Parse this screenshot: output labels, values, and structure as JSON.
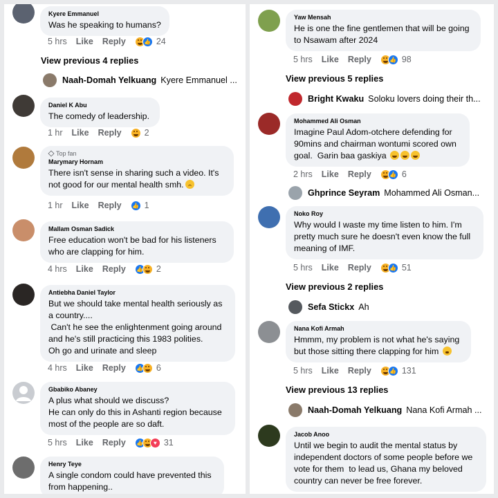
{
  "left": {
    "top_comment": {
      "author": "Kyere Emmanuel",
      "text": "Was he speaking to humans?",
      "time": "5 hrs",
      "like": "Like",
      "reply": "Reply",
      "count": "24"
    },
    "view_previous": "View previous 4 replies",
    "reply_preview": {
      "author": "Naah-Domah Yelkuang",
      "snippet": "Kyere Emmanuel ..."
    },
    "comments": [
      {
        "author": "Daniel K Abu",
        "text": "The comedy of leadership.",
        "time": "1 hr",
        "like": "Like",
        "reply": "Reply",
        "count": "2"
      },
      {
        "badge": "Top fan",
        "author": "Marymary Hornam",
        "text": "There isn't sense in sharing such a video. It's not good for our mental health smh.",
        "time": "1 hr",
        "like": "Like",
        "reply": "Reply",
        "count": "1"
      },
      {
        "author": "Mallam Osman Sadick",
        "text": "Free education won't be bad for his listeners who are clapping for him.",
        "time": "4 hrs",
        "like": "Like",
        "reply": "Reply",
        "count": "2"
      },
      {
        "author": "Antiebha Daniel Taylor",
        "text": "But we should take mental health seriously as a country....\n Can't he see the enlightenment going around and he's still practicing this 1983 polities.\nOh go and urinate and sleep",
        "time": "4 hrs",
        "like": "Like",
        "reply": "Reply",
        "count": "6"
      },
      {
        "author": "Gbabiko Abaney",
        "text": "A plus what should we discuss?\nHe can only do this in Ashanti region because most of the people are so daft.",
        "time": "5 hrs",
        "like": "Like",
        "reply": "Reply",
        "count": "31"
      },
      {
        "author": "Henry Teye",
        "text": "A single condom could have prevented this from happening.."
      }
    ]
  },
  "right": {
    "top_comment": {
      "author": "Yaw Mensah",
      "text": "He is one the fine gentlemen that will be going to Nsawam after 2024",
      "time": "5 hrs",
      "like": "Like",
      "reply": "Reply",
      "count": "98"
    },
    "view_previous_1": "View previous 5 replies",
    "reply_preview_1": {
      "author": "Bright Kwaku",
      "snippet": "Soloku lovers doing their th..."
    },
    "comment_2": {
      "author": "Mohammed Ali Osman",
      "text": "Imagine Paul Adom-otchere defending for 90mins and chairman wontumi scored own goal.  Garin baa gaskiya",
      "time": "2 hrs",
      "like": "Like",
      "reply": "Reply",
      "count": "6"
    },
    "reply_preview_2": {
      "author": "Ghprince Seyram",
      "snippet": "Mohammed Ali Osman..."
    },
    "comment_3": {
      "author": "Noko Roy",
      "text": "Why would I waste my time listen to him. I'm pretty much sure he doesn't even know the full meaning of IMF.",
      "time": "5 hrs",
      "like": "Like",
      "reply": "Reply",
      "count": "51"
    },
    "view_previous_2": "View previous 2 replies",
    "reply_preview_3": {
      "author": "Sefa Stickx",
      "snippet": "Ah"
    },
    "comment_4": {
      "author": "Nana Kofi Armah",
      "text": "Hmmm, my problem is not what he's saying but those sitting there clapping for him",
      "time": "5 hrs",
      "like": "Like",
      "reply": "Reply",
      "count": "131"
    },
    "view_previous_3": "View previous 13 replies",
    "reply_preview_4": {
      "author": "Naah-Domah Yelkuang",
      "snippet": "Nana Kofi Armah ..."
    },
    "comment_5": {
      "author": "Jacob Anoo",
      "text": "Until we begin to audit the mental status by independent doctors of some people before we vote for them  to lead us, Ghana my beloved country can never be free forever."
    }
  },
  "colors": {
    "like_blue": "#1877f2",
    "haha_yellow": "#f7b125",
    "love_red": "#f33e58",
    "bubble_gray": "#f0f2f5",
    "meta_gray": "#65676b"
  }
}
